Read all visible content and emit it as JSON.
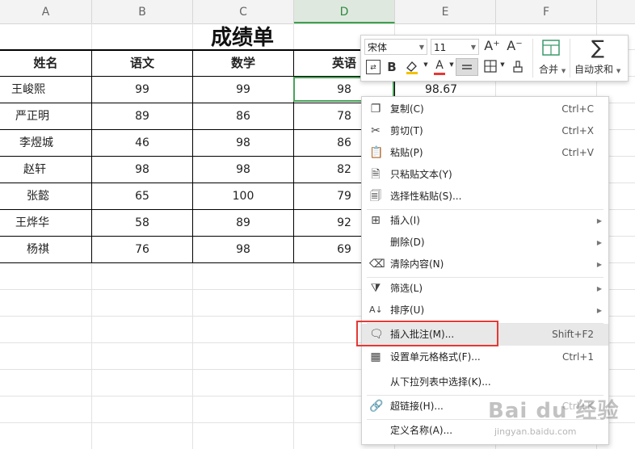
{
  "columns": [
    "A",
    "B",
    "C",
    "D",
    "E",
    "F"
  ],
  "sheet": {
    "title": "成绩单",
    "headers": [
      "姓名",
      "语文",
      "数学",
      "英语"
    ],
    "rows": [
      [
        "王峻熙",
        "99",
        "99",
        "98"
      ],
      [
        "严正明",
        "89",
        "86",
        "78"
      ],
      [
        "李煜城",
        "46",
        "98",
        "86"
      ],
      [
        "赵轩",
        "98",
        "98",
        "82"
      ],
      [
        "张懿",
        "65",
        "100",
        "79"
      ],
      [
        "王烨华",
        "58",
        "89",
        "92"
      ],
      [
        "杨祺",
        "76",
        "98",
        "69"
      ]
    ],
    "e_value": "98.67"
  },
  "toolbar": {
    "font_name": "宋体",
    "font_size": "11",
    "grow_font": "A⁺",
    "shrink_font": "A⁻",
    "bold": "B",
    "merge_label": "合并",
    "autosum_label": "自动求和"
  },
  "menu": {
    "items": [
      {
        "label": "复制(C)",
        "shortcut": "Ctrl+C",
        "icon": "copy-icon"
      },
      {
        "label": "剪切(T)",
        "shortcut": "Ctrl+X",
        "icon": "cut-icon"
      },
      {
        "label": "粘贴(P)",
        "shortcut": "Ctrl+V",
        "icon": "paste-icon"
      },
      {
        "label": "只粘贴文本(Y)",
        "shortcut": "",
        "icon": "paste-text-icon"
      },
      {
        "label": "选择性粘贴(S)...",
        "shortcut": "",
        "icon": "paste-special-icon"
      },
      {
        "label": "插入(I)",
        "shortcut": "",
        "icon": "insert-icon"
      },
      {
        "label": "删除(D)",
        "shortcut": "",
        "icon": ""
      },
      {
        "label": "清除内容(N)",
        "shortcut": "",
        "icon": "eraser-icon"
      },
      {
        "label": "筛选(L)",
        "shortcut": "",
        "icon": "filter-icon"
      },
      {
        "label": "排序(U)",
        "shortcut": "",
        "icon": "sort-icon"
      },
      {
        "label": "插入批注(M)...",
        "shortcut": "Shift+F2",
        "icon": "comment-icon"
      },
      {
        "label": "设置单元格格式(F)...",
        "shortcut": "Ctrl+1",
        "icon": "format-cells-icon"
      },
      {
        "label": "从下拉列表中选择(K)...",
        "shortcut": "",
        "icon": ""
      },
      {
        "label": "超链接(H)...",
        "shortcut": "Ctrl+K",
        "icon": "link-icon"
      },
      {
        "label": "定义名称(A)...",
        "shortcut": "",
        "icon": ""
      }
    ]
  },
  "watermark": {
    "logo": "Bai du 经验",
    "url": "jingyan.baidu.com"
  }
}
